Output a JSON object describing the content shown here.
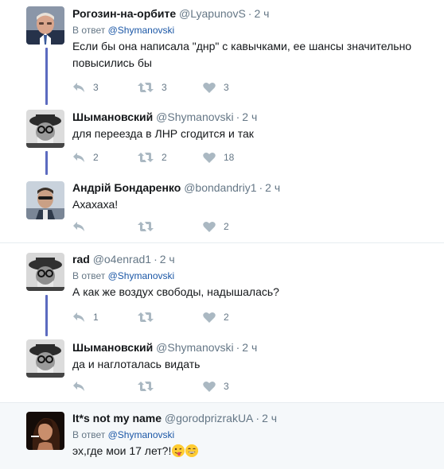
{
  "tweets": [
    {
      "name": "Рогозин-на-орбите",
      "handle": "@LyapunovS",
      "time": "2 ч",
      "reply_label": "В ответ",
      "reply_mention": "@Shymanovski",
      "text": "Если бы она написала \"днр\" с кавычками, ее шансы значительно повысились бы",
      "reply_count": "3",
      "retweet_count": "3",
      "like_count": "3"
    },
    {
      "name": "Шымановский",
      "handle": "@Shymanovski",
      "time": "2 ч",
      "text": "для переезда в ЛНР сгодится и так",
      "reply_count": "2",
      "retweet_count": "2",
      "like_count": "18"
    },
    {
      "name": "Андрій Бондаренко",
      "handle": "@bondandriy1",
      "time": "2 ч",
      "text": "Ахахаха!",
      "reply_count": "",
      "retweet_count": "",
      "like_count": "2"
    },
    {
      "name": "rad",
      "handle": "@o4enrad1",
      "time": "2 ч",
      "reply_label": "В ответ",
      "reply_mention": "@Shymanovski",
      "text": "А как же воздух свободы, надышалась?",
      "reply_count": "1",
      "retweet_count": "",
      "like_count": "2"
    },
    {
      "name": "Шымановский",
      "handle": "@Shymanovski",
      "time": "2 ч",
      "text": "да и наглоталась видать",
      "reply_count": "",
      "retweet_count": "",
      "like_count": "3"
    },
    {
      "name": "It*s not my name",
      "handle": "@gorodprizrakUA",
      "time": "2 ч",
      "reply_label": "В ответ",
      "reply_mention": "@Shymanovski",
      "text": "эх,где мои 17 лет?!"
    }
  ],
  "colors": {
    "thread_line": "#5c6bc0",
    "action_icon": "#aab8c2",
    "mention": "#1b57a6",
    "highlight_bg": "#f5f8fa"
  },
  "icons": [
    "reply-icon",
    "retweet-icon",
    "like-icon",
    "winking-face-tongue-emoji",
    "grinning-face-emoji"
  ]
}
